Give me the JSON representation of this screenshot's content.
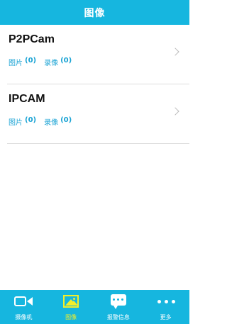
{
  "header": {
    "title": "图像"
  },
  "devices": [
    {
      "name": "P2PCam",
      "pictures_label": "图片",
      "pictures_count": "(0)",
      "videos_label": "录像",
      "videos_count": "(0)"
    },
    {
      "name": "IPCAM",
      "pictures_label": "图片",
      "pictures_count": "(0)",
      "videos_label": "录像",
      "videos_count": "(0)"
    }
  ],
  "tabbar": {
    "items": [
      {
        "label": "摄像机",
        "icon": "video-camera-icon"
      },
      {
        "label": "图像",
        "icon": "image-icon",
        "active": true
      },
      {
        "label": "报警信息",
        "icon": "message-icon"
      },
      {
        "label": "更多",
        "icon": "more-icon"
      }
    ]
  },
  "colors": {
    "accent": "#16b6df",
    "active_tab": "#f3ee2a",
    "count_text": "#1aa3d4"
  }
}
